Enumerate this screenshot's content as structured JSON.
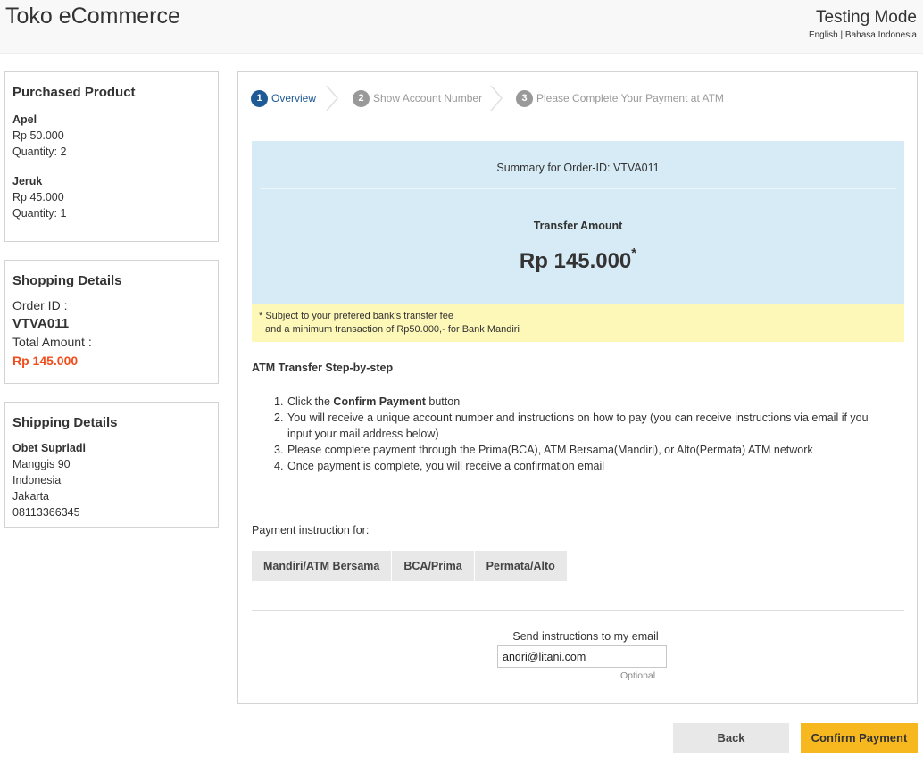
{
  "header": {
    "brand": "Toko eCommerce",
    "mode": "Testing Mode",
    "lang_english": "English",
    "lang_separator": "|",
    "lang_indonesia": "Bahasa Indonesia"
  },
  "purchased": {
    "title": "Purchased Product",
    "items": [
      {
        "name": "Apel",
        "price": "Rp 50.000",
        "quantity": "Quantity: 2"
      },
      {
        "name": "Jeruk",
        "price": "Rp 45.000",
        "quantity": "Quantity: 1"
      }
    ]
  },
  "shopping": {
    "title": "Shopping Details",
    "order_label": "Order ID :",
    "order_id": "VTVA011",
    "total_label": "Total Amount :",
    "total_value": "Rp 145.000"
  },
  "shipping": {
    "title": "Shipping Details",
    "name": "Obet Supriadi",
    "address": "Manggis 90",
    "country": "Indonesia",
    "city": "Jakarta",
    "phone": "08113366345"
  },
  "steps": [
    {
      "num": "1",
      "label": "Overview",
      "active": true
    },
    {
      "num": "2",
      "label": "Show Account Number",
      "active": false
    },
    {
      "num": "3",
      "label": "Please Complete Your Payment at ATM",
      "active": false
    }
  ],
  "summary": {
    "title": "Summary for Order-ID: VTVA011",
    "transfer_label": "Transfer Amount",
    "amount": "Rp 145.000",
    "asterisk": "*"
  },
  "note": {
    "line1": "* Subject to your prefered bank's transfer fee",
    "line2": "and a minimum transaction of Rp50.000,- for Bank Mandiri"
  },
  "atm": {
    "title": "ATM Transfer Step-by-step",
    "step1_prefix": "Click the",
    "step1_bold": "Confirm Payment",
    "step1_suffix": "button",
    "step2_line1": "You will receive a unique account number and instructions on how to pay (you can receive instructions via email if you",
    "step2_line2": "input your mail address below)",
    "step3": "Please complete payment through the Prima(BCA), ATM Bersama(Mandiri), or Alto(Permata) ATM network",
    "step4": "Once payment is complete, you will receive a confirmation email",
    "idx1": "1.",
    "idx2": "2.",
    "idx3": "3.",
    "idx4": "4."
  },
  "payment_instruction": {
    "label": "Payment instruction for:",
    "tabs": [
      "Mandiri/ATM Bersama",
      "BCA/Prima",
      "Permata/Alto"
    ]
  },
  "email": {
    "label": "Send instructions to my email",
    "value": "andri@litani.com",
    "optional": "Optional"
  },
  "buttons": {
    "back": "Back",
    "confirm": "Confirm Payment"
  },
  "colors": {
    "accent_blue": "#1e5a96",
    "confirm_yellow": "#f7b71e",
    "total_orange": "#f04e1d",
    "summary_bg": "#d6ebf5",
    "note_bg": "#fdf7b8"
  }
}
